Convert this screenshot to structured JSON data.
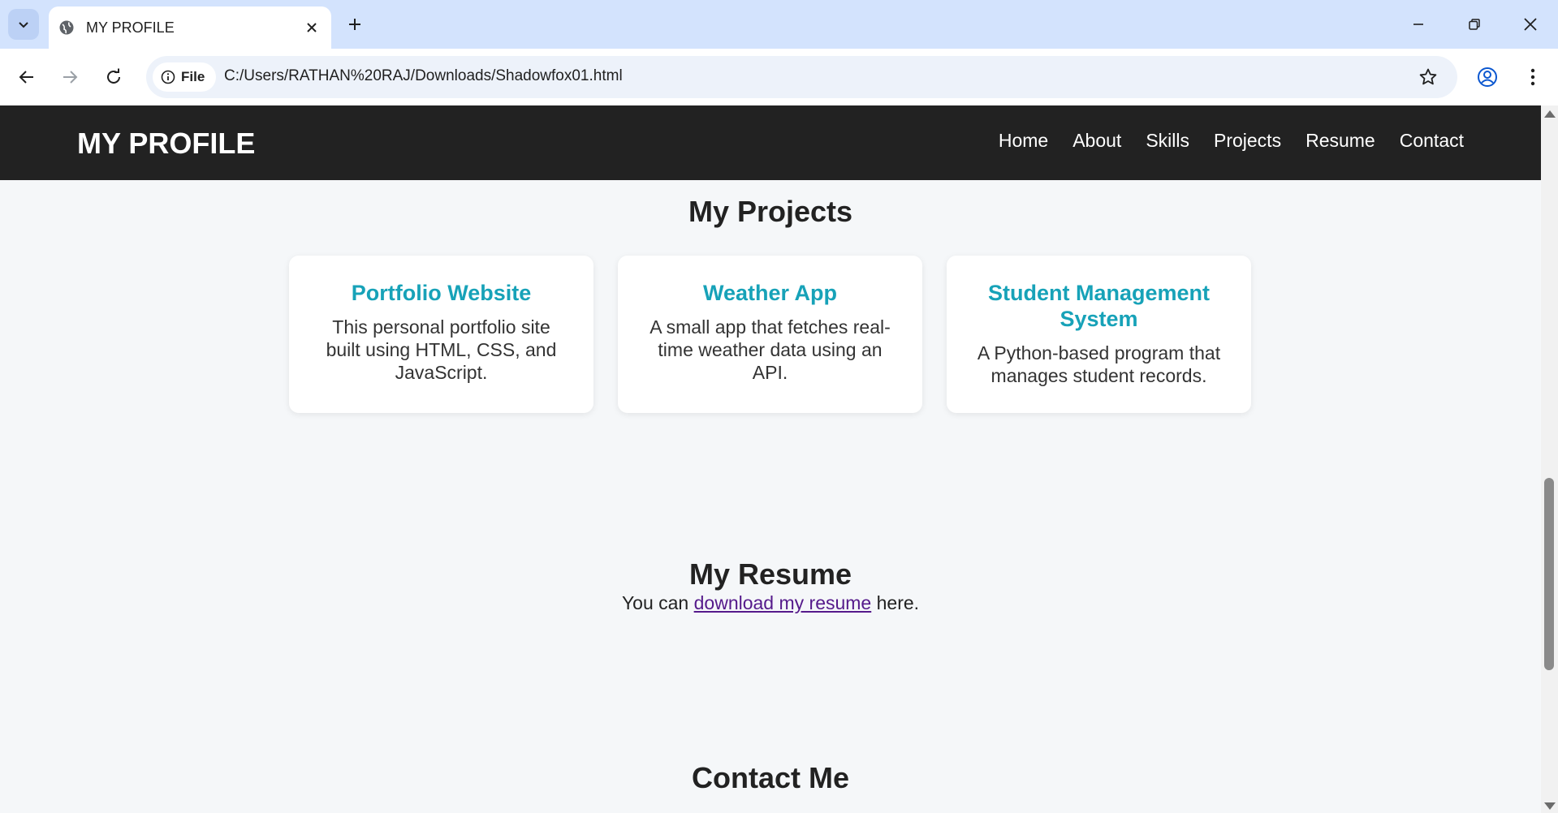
{
  "browser": {
    "tab_title": "MY PROFILE",
    "site_chip_label": "File",
    "url": "C:/Users/RATHAN%20RAJ/Downloads/Shadowfox01.html"
  },
  "site": {
    "brand": "MY PROFILE",
    "nav": [
      "Home",
      "About",
      "Skills",
      "Projects",
      "Resume",
      "Contact"
    ]
  },
  "projects": {
    "title": "My Projects",
    "cards": [
      {
        "title": "Portfolio Website",
        "desc": "This personal portfolio site built using HTML, CSS, and JavaScript."
      },
      {
        "title": "Weather App",
        "desc": "A small app that fetches real-time weather data using an API."
      },
      {
        "title": "Student Management System",
        "desc": "A Python-based program that manages student records."
      }
    ]
  },
  "resume": {
    "title": "My Resume",
    "text_before": "You can ",
    "link_text": "download my resume",
    "text_after": " here."
  },
  "contact": {
    "title": "Contact Me"
  },
  "colors": {
    "header_bg": "#222222",
    "accent": "#17a2b8",
    "link_visited": "#551a8b",
    "tabbar_bg": "#d3e3fd"
  }
}
